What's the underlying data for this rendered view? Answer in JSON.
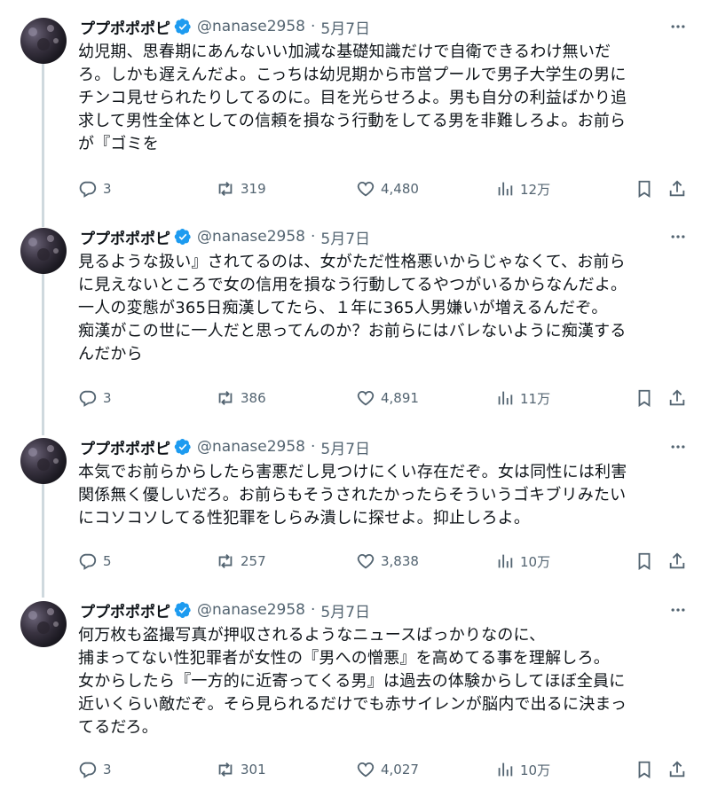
{
  "author": {
    "name": "ププポポポピ",
    "handle": "@nanase2958",
    "separator": "·"
  },
  "tweets": [
    {
      "date": "5月7日",
      "text": "幼児期、思春期にあんないい加減な基礎知識だけで自衛できるわけ無いだ\nろ。しかも遅えんだよ。こっちは幼児期から市営プールで男子大学生の男に\nチンコ見せられたりしてるのに。目を光らせろよ。男も自分の利益ばかり追\n求して男性全体としての信頼を損なう行動をしてる男を非難しろよ。お前ら\nが『ゴミを",
      "replies": "3",
      "retweets": "319",
      "likes": "4,480",
      "views": "12万"
    },
    {
      "date": "5月7日",
      "text": "見るような扱い』されてるのは、女がただ性格悪いからじゃなくて、お前ら\nに見えないところで女の信用を損なう行動してるやつがいるからなんだよ。\n一人の変態が365日痴漢してたら、１年に365人男嫌いが増えるんだぞ。\n痴漢がこの世に一人だと思ってんのか？お前らにはバレないように痴漢する\nんだから",
      "replies": "3",
      "retweets": "386",
      "likes": "4,891",
      "views": "11万"
    },
    {
      "date": "5月7日",
      "text": "本気でお前らからしたら害悪だし見つけにくい存在だぞ。女は同性には利害\n関係無く優しいだろ。お前らもそうされたかったらそういうゴキブリみたい\nにコソコソしてる性犯罪をしらみ潰しに探せよ。抑止しろよ。",
      "replies": "5",
      "retweets": "257",
      "likes": "3,838",
      "views": "10万"
    },
    {
      "date": "5月7日",
      "text": "何万枚も盗撮写真が押収されるようなニュースばっかりなのに、\n捕まってない性犯罪者が女性の『男への憎悪』を高めてる事を理解しろ。\n女からしたら『一方的に近寄ってくる男』は過去の体験からしてほぼ全員に\n近いくらい敵だぞ。そら見られるだけでも赤サイレンが脳内で出るに決まっ\nてるだろ。",
      "replies": "3",
      "retweets": "301",
      "likes": "4,027",
      "views": "10万"
    }
  ],
  "colors": {
    "text": "#0f1419",
    "secondary": "#536471",
    "verified": "#1d9bf0",
    "thread_line": "#cfd9de"
  },
  "icons": {
    "verified": "verified-badge-icon",
    "more": "more-horizontal-icon",
    "reply": "reply-icon",
    "retweet": "retweet-icon",
    "like": "heart-icon",
    "views": "views-bar-chart-icon",
    "bookmark": "bookmark-icon",
    "share": "share-icon"
  }
}
